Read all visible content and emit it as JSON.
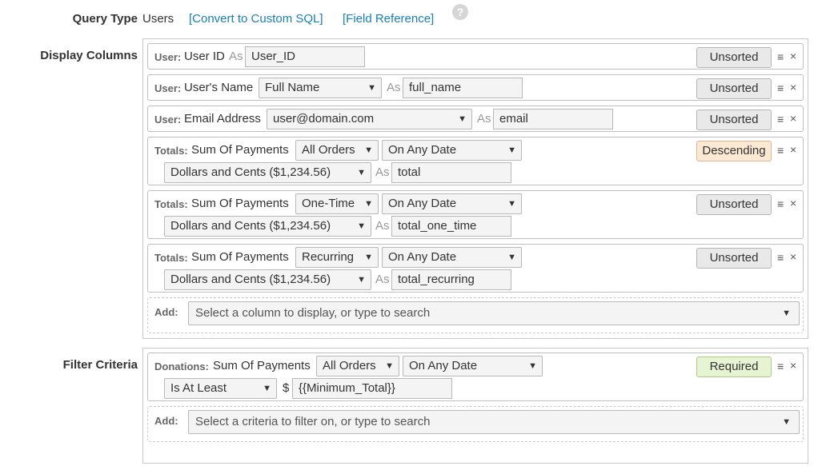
{
  "query_type": {
    "label": "Query Type",
    "value": "Users",
    "convert_link": "[Convert to Custom SQL]",
    "field_reference_link": "[Field Reference]",
    "help_glyph": "?"
  },
  "display_columns": {
    "label": "Display Columns",
    "rows": [
      {
        "prefix": "User:",
        "field": "User ID",
        "as": "As",
        "alias": "User_ID",
        "sort": "Unsorted"
      },
      {
        "prefix": "User:",
        "field": "User's Name",
        "format": "Full Name",
        "as": "As",
        "alias": "full_name",
        "sort": "Unsorted"
      },
      {
        "prefix": "User:",
        "field": "Email Address",
        "format": "user@domain.com",
        "as": "As",
        "alias": "email",
        "sort": "Unsorted"
      },
      {
        "prefix": "Totals:",
        "field": "Sum Of Payments",
        "orders": "All Orders",
        "date": "On Any Date",
        "money_format": "Dollars and Cents ($1,234.56)",
        "as": "As",
        "alias": "total",
        "sort": "Descending"
      },
      {
        "prefix": "Totals:",
        "field": "Sum Of Payments",
        "orders": "One-Time",
        "date": "On Any Date",
        "money_format": "Dollars and Cents ($1,234.56)",
        "as": "As",
        "alias": "total_one_time",
        "sort": "Unsorted"
      },
      {
        "prefix": "Totals:",
        "field": "Sum Of Payments",
        "orders": "Recurring",
        "date": "On Any Date",
        "money_format": "Dollars and Cents ($1,234.56)",
        "as": "As",
        "alias": "total_recurring",
        "sort": "Unsorted"
      }
    ],
    "add_label": "Add:",
    "add_placeholder": "Select a column to display, or type to search"
  },
  "filter_criteria": {
    "label": "Filter Criteria",
    "rows": [
      {
        "prefix": "Donations:",
        "field": "Sum Of Payments",
        "orders": "All Orders",
        "date": "On Any Date",
        "comparison": "Is At Least",
        "currency": "$",
        "value": "{{Minimum_Total}}",
        "status": "Required"
      }
    ],
    "add_label": "Add:",
    "add_placeholder": "Select a criteria to filter on, or type to search"
  },
  "glyphs": {
    "dropdown": "▼",
    "menu": "≡",
    "close": "×"
  },
  "colors": {
    "link": "#1a7fb0",
    "descending_bg": "#fbe9d4",
    "required_bg": "#e7f4d4"
  }
}
